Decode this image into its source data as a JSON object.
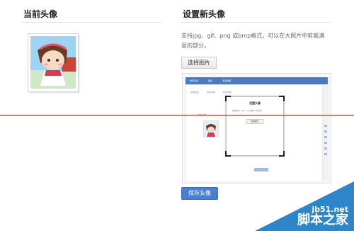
{
  "current_avatar": {
    "title": "当前头像"
  },
  "new_avatar": {
    "title": "设置新头像",
    "hint": "支持jpg、gif、png 或bmp格式，可以在大照片中剪裁满意的部分。",
    "choose_button": "选择图片",
    "save_button": "保存头像"
  },
  "preview": {
    "tabs": [
      "帐号设置",
      "隐私",
      "消息提醒"
    ],
    "subtabs": [
      "头像设置",
      "基本资料",
      "修改密码"
    ],
    "avatar_label": "当前头像",
    "dialog": {
      "title": "设置头像",
      "text": "支持jpg、gif、png或bmp格式",
      "button": "选择图片"
    }
  },
  "watermark": {
    "domain": "jb51.net",
    "name": "脚本之家"
  },
  "colors": {
    "accent": "#4a7fd0",
    "divider_line": "#d01c1c",
    "watermark": "#2e86c9"
  }
}
